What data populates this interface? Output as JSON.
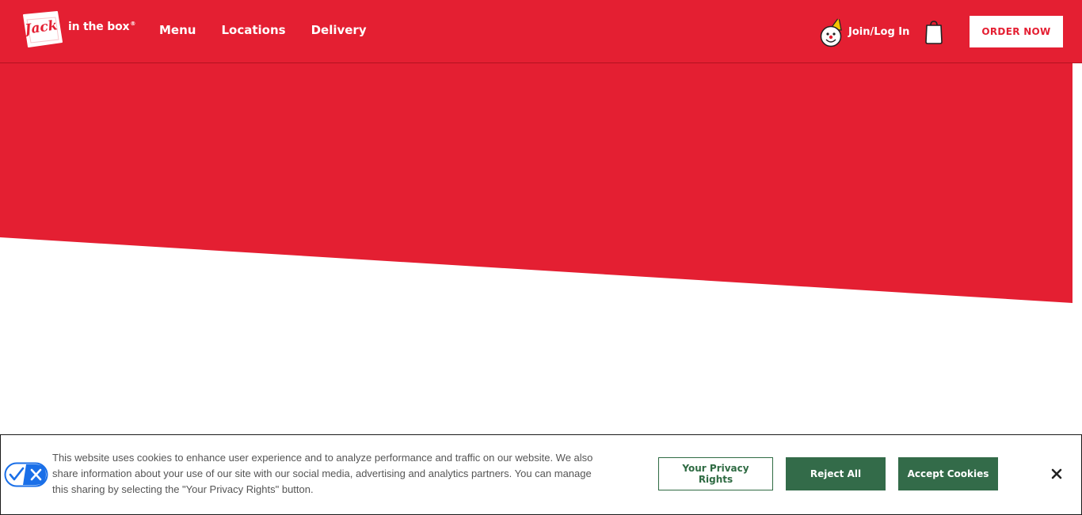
{
  "brand": {
    "logo_word": "Jack",
    "logo_tagline": "in the box",
    "logo_registered": "®"
  },
  "nav": {
    "items": [
      {
        "label": "Menu"
      },
      {
        "label": "Locations"
      },
      {
        "label": "Delivery"
      }
    ]
  },
  "account": {
    "label": "Join/Log In"
  },
  "order_button": {
    "label": "ORDER NOW"
  },
  "cookie_banner": {
    "text": "This website uses cookies to enhance user experience and to analyze performance and traffic on our website. We also share information about your use of our site with our social media, advertising and analytics partners. You can manage this sharing by selecting the \"Your Privacy Rights\" button.",
    "privacy_rights_label": "Your Privacy Rights",
    "reject_label": "Reject All",
    "accept_label": "Accept Cookies"
  },
  "colors": {
    "brand_red": "#e41f32",
    "cookie_green": "#336b49",
    "privacy_blue": "#1a6fe8"
  },
  "icons": {
    "logo": "jack-in-the-box-logo",
    "account": "jack-mascot-icon",
    "cart": "shopping-bag-icon",
    "privacy": "privacy-choices-icon",
    "close": "close-icon"
  }
}
